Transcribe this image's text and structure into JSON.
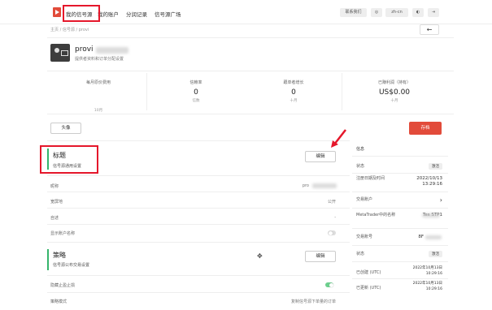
{
  "topbar": {
    "nav": [
      "我的信号源",
      "我的账户",
      "分润记录",
      "信号源广场"
    ],
    "buttons": [
      "联系我们",
      "◎",
      "zh-cn",
      "◐",
      "⇥"
    ]
  },
  "breadcrumb": "主页 / 信号源 / provi",
  "back_label": "←",
  "provider": {
    "name": "provi",
    "subtitle": "提供者资料和订单分配设置"
  },
  "stats": [
    {
      "label": "每月原价费用",
      "value": "",
      "sub": "10月"
    },
    {
      "label": "信赖率",
      "value": "0",
      "sub": "信数"
    },
    {
      "label": "跟单者增长",
      "value": "0",
      "sub": "十月"
    },
    {
      "label": "已赚利润（持有）",
      "value": "US$0.00",
      "sub": "十月"
    }
  ],
  "buttons": {
    "outline": "头像",
    "red": "存档",
    "edit": "编辑"
  },
  "title_section": {
    "title": "标题",
    "subtitle": "信号源通用设置",
    "rows": [
      {
        "label": "昵称",
        "value": "pro"
      },
      {
        "label": "宽屏地",
        "value": "公开"
      },
      {
        "label": "自述",
        "value": "-"
      },
      {
        "label": "显示账户名称",
        "value": ""
      }
    ]
  },
  "strategy_section": {
    "title": "策略",
    "subtitle": "信号源公布交易设置",
    "rows": [
      {
        "label": "隐藏止盈止损",
        "value": ""
      },
      {
        "label": "策略模式",
        "value": "复制信号源下单量的订单"
      }
    ]
  },
  "info_panel": {
    "header": "信息",
    "rows": [
      {
        "label": "状态",
        "value": "激活"
      },
      {
        "label": "注册日期及时间",
        "value": "2022/10/13 13:29:16"
      },
      {
        "label": "交易账户",
        "value": "›"
      },
      {
        "label": "MetaTrader中的名称",
        "value": "Tes STP1"
      },
      {
        "label": "交易账号",
        "value": "8F"
      },
      {
        "label": "状态",
        "value": "激活"
      },
      {
        "label": "已创建 (UTC)",
        "value": "2022年10月13日 10:29:16"
      },
      {
        "label": "已更新 (UTC)",
        "value": "2022年10月13日 10:29:16"
      }
    ]
  },
  "colors": {
    "accent": "#e24b3a",
    "highlight": "#e5172b",
    "green": "#35b56b"
  }
}
